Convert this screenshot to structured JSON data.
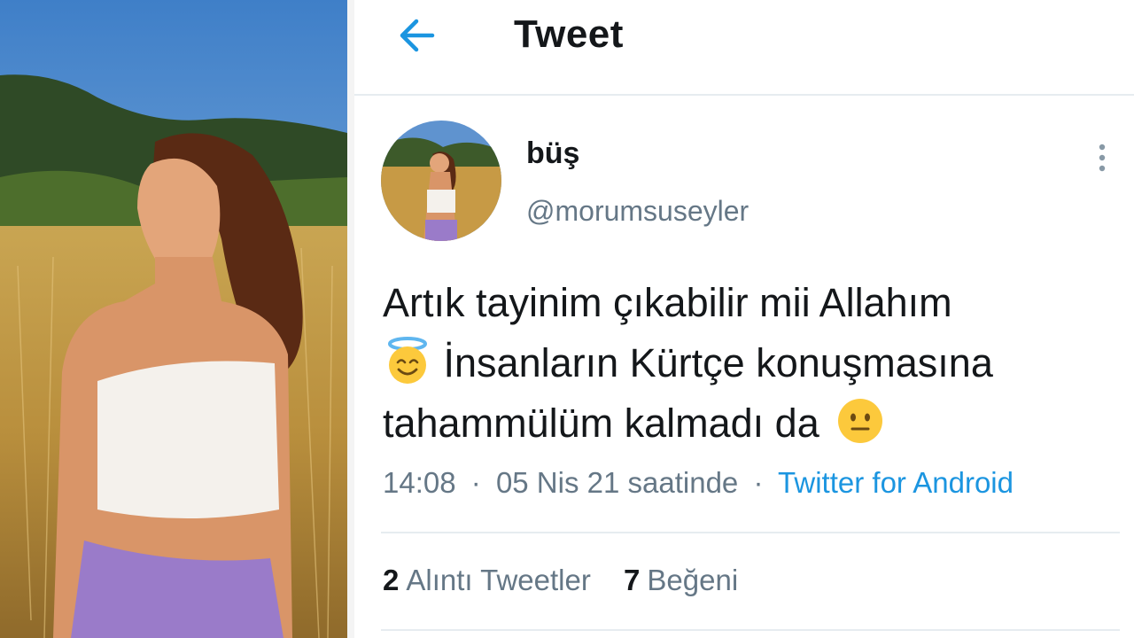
{
  "header": {
    "title": "Tweet",
    "back_icon": "back-arrow-icon"
  },
  "tweet": {
    "display_name": "büş",
    "handle": "@morumsuseyler",
    "text_line1": "Artık tayinim çıkabilir mii Allahım",
    "text_line2": "İnsanların Kürtçe konuşmasına",
    "text_line3": "tahammülüm kalmadı da",
    "emoji_1": "smiling-face-with-halo-emoji",
    "emoji_2": "neutral-face-emoji",
    "time": "14:08",
    "date": "05 Nis 21 saatinde",
    "separator": "·",
    "source": "Twitter for Android",
    "quote_count": "2",
    "quote_label": "Alıntı Tweetler",
    "like_count": "7",
    "like_label": "Beğeni"
  },
  "colors": {
    "accent": "#1b95e0",
    "text_primary": "#14171a",
    "text_secondary": "#657786",
    "divider": "#e6ecf0"
  }
}
